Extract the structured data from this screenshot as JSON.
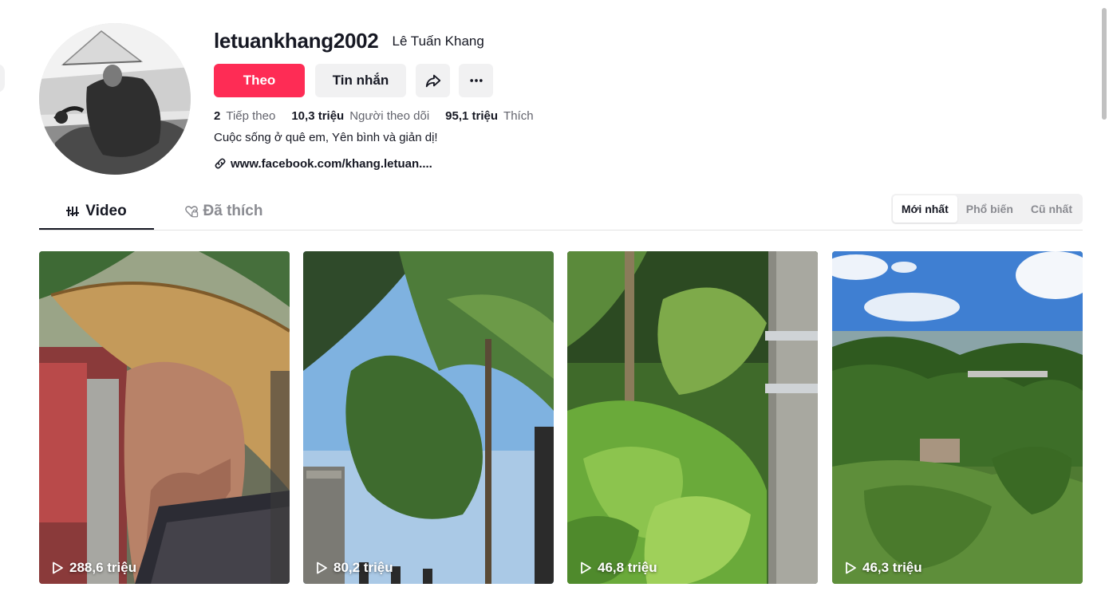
{
  "profile": {
    "username": "letuankhang2002",
    "nickname": "Lê Tuấn Khang",
    "avatar_icon": "avatar-photo"
  },
  "actions": {
    "follow_label": "Theo",
    "message_label": "Tin nhắn",
    "share_icon": "share-arrow-icon",
    "more_icon": "more-dots-icon",
    "follow_color": "#fe2c55"
  },
  "stats": {
    "following_count": "2",
    "following_label": "Tiếp theo",
    "followers_count": "10,3 triệu",
    "followers_label": "Người theo dõi",
    "likes_count": "95,1 triệu",
    "likes_label": "Thích"
  },
  "bio": "Cuộc sống ở quê em, Yên bình và giản dị!",
  "link": {
    "text": "www.facebook.com/khang.letuan....",
    "icon": "link-icon"
  },
  "tabs": [
    {
      "label": "Video",
      "icon": "grid-bars-icon",
      "active": true
    },
    {
      "label": "Đã thích",
      "icon": "heart-lock-icon",
      "active": false
    }
  ],
  "sort": {
    "options": [
      "Mới nhất",
      "Phổ biến",
      "Cũ nhất"
    ],
    "selected": "Mới nhất"
  },
  "videos": [
    {
      "views": "288,6 triệu",
      "thumbnail": "woman-conical-hat"
    },
    {
      "views": "80,2 triệu",
      "thumbnail": "coconut-palm-sky"
    },
    {
      "views": "46,8 triệu",
      "thumbnail": "green-garden-pole"
    },
    {
      "views": "46,3 triệu",
      "thumbnail": "aerial-coconut-farm"
    }
  ]
}
